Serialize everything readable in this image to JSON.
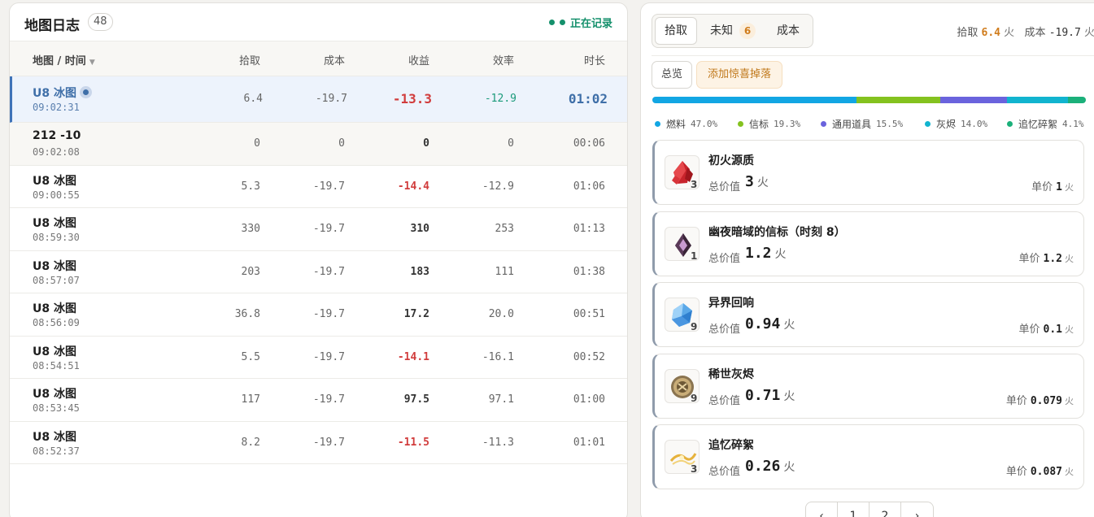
{
  "map_log": {
    "title": "地图日志",
    "count": "48",
    "recording_status": "正在记录",
    "columns": {
      "map_time": "地图 / 时间",
      "pickup": "拾取",
      "cost": "成本",
      "profit": "收益",
      "efficiency": "效率",
      "duration": "时长"
    },
    "rows": [
      {
        "name": "U8 冰图",
        "time": "09:02:31",
        "pickup": "6.4",
        "cost": "-19.7",
        "profit": "-13.3",
        "efficiency": "-12.9",
        "duration": "01:02"
      },
      {
        "name": "212 -10",
        "time": "09:02:08",
        "pickup": "0",
        "cost": "0",
        "profit": "0",
        "efficiency": "0",
        "duration": "00:06"
      },
      {
        "name": "U8 冰图",
        "time": "09:00:55",
        "pickup": "5.3",
        "cost": "-19.7",
        "profit": "-14.4",
        "efficiency": "-12.9",
        "duration": "01:06"
      },
      {
        "name": "U8 冰图",
        "time": "08:59:30",
        "pickup": "330",
        "cost": "-19.7",
        "profit": "310",
        "efficiency": "253",
        "duration": "01:13"
      },
      {
        "name": "U8 冰图",
        "time": "08:57:07",
        "pickup": "203",
        "cost": "-19.7",
        "profit": "183",
        "efficiency": "111",
        "duration": "01:38"
      },
      {
        "name": "U8 冰图",
        "time": "08:56:09",
        "pickup": "36.8",
        "cost": "-19.7",
        "profit": "17.2",
        "efficiency": "20.0",
        "duration": "00:51"
      },
      {
        "name": "U8 冰图",
        "time": "08:54:51",
        "pickup": "5.5",
        "cost": "-19.7",
        "profit": "-14.1",
        "efficiency": "-16.1",
        "duration": "00:52"
      },
      {
        "name": "U8 冰图",
        "time": "08:53:45",
        "pickup": "117",
        "cost": "-19.7",
        "profit": "97.5",
        "efficiency": "97.1",
        "duration": "01:00"
      },
      {
        "name": "U8 冰图",
        "time": "08:52:37",
        "pickup": "8.2",
        "cost": "-19.7",
        "profit": "-11.5",
        "efficiency": "-11.3",
        "duration": "01:01"
      }
    ]
  },
  "detail": {
    "tabs": {
      "pickup": "拾取",
      "unknown": "未知",
      "unknown_count": "6",
      "cost": "成本"
    },
    "summary": {
      "pickup_label": "拾取",
      "pickup_value": "6.4",
      "cost_label": "成本",
      "cost_value": "-19.7",
      "unit": "火"
    },
    "buttons": {
      "overview": "总览",
      "add_drop": "添加惊喜掉落"
    },
    "breakdown": [
      {
        "name": "燃料",
        "pct": "47.0%",
        "value": 47.0,
        "color": "#12a6e3"
      },
      {
        "name": "信标",
        "pct": "19.3%",
        "value": 19.3,
        "color": "#84c21f"
      },
      {
        "name": "通用道具",
        "pct": "15.5%",
        "value": 15.5,
        "color": "#6a63dd"
      },
      {
        "name": "灰烬",
        "pct": "14.0%",
        "value": 14.0,
        "color": "#11b4cf"
      },
      {
        "name": "追忆碎絮",
        "pct": "4.1%",
        "value": 4.1,
        "color": "#1bb07a"
      }
    ],
    "items": [
      {
        "name": "初火源质",
        "qty": "3",
        "total_label": "总价值",
        "total": "3",
        "unit": "火",
        "price_label": "单价",
        "price": "1",
        "icon": "red-crystal-icon"
      },
      {
        "name": "幽夜暗域的信标（时刻 8）",
        "qty": "1",
        "total_label": "总价值",
        "total": "1.2",
        "unit": "火",
        "price_label": "单价",
        "price": "1.2",
        "icon": "dark-beacon-icon"
      },
      {
        "name": "异界回响",
        "qty": "9",
        "total_label": "总价值",
        "total": "0.94",
        "unit": "火",
        "price_label": "单价",
        "price": "0.1",
        "icon": "blue-crystal-icon"
      },
      {
        "name": "稀世灰烬",
        "qty": "9",
        "total_label": "总价值",
        "total": "0.71",
        "unit": "火",
        "price_label": "单价",
        "price": "0.079",
        "icon": "ash-coin-icon"
      },
      {
        "name": "追忆碎絮",
        "qty": "3",
        "total_label": "总价值",
        "total": "0.26",
        "unit": "火",
        "price_label": "单价",
        "price": "0.087",
        "icon": "golden-wisp-icon"
      }
    ],
    "pager": [
      "‹",
      "1",
      "2",
      "›"
    ]
  }
}
